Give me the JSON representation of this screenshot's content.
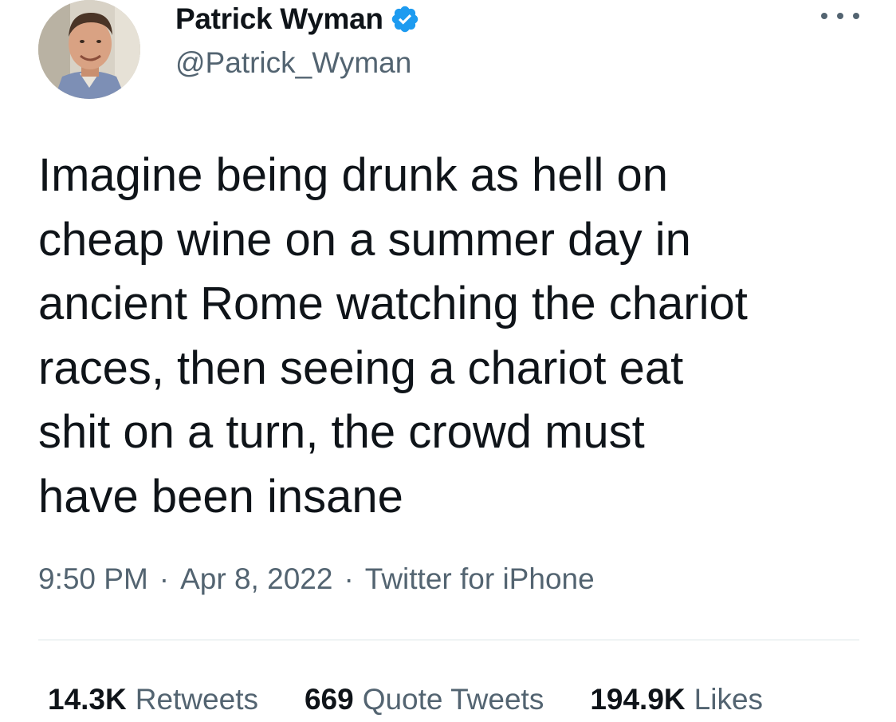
{
  "author": {
    "display_name": "Patrick Wyman",
    "handle": "@Patrick_Wyman",
    "verified": true,
    "avatar_icon": "profile-photo"
  },
  "menu_icon": "more-options-icon",
  "tweet": {
    "text": "Imagine being drunk as hell on\ncheap wine on a summer day in\nancient Rome watching the chariot\nraces, then seeing a chariot eat\nshit on a turn, the crowd must\nhave been insane",
    "time": "9:50 PM",
    "date": "Apr 8, 2022",
    "source": "Twitter for iPhone",
    "separator": "·"
  },
  "stats": {
    "retweets_count": "14.3K",
    "retweets_label": "Retweets",
    "quotes_count": "669",
    "quotes_label": "Quote Tweets",
    "likes_count": "194.9K",
    "likes_label": "Likes"
  },
  "colors": {
    "text": "#0f1419",
    "secondary": "#536471",
    "verified_blue": "#1d9bf0",
    "divider": "#eff3f4"
  }
}
